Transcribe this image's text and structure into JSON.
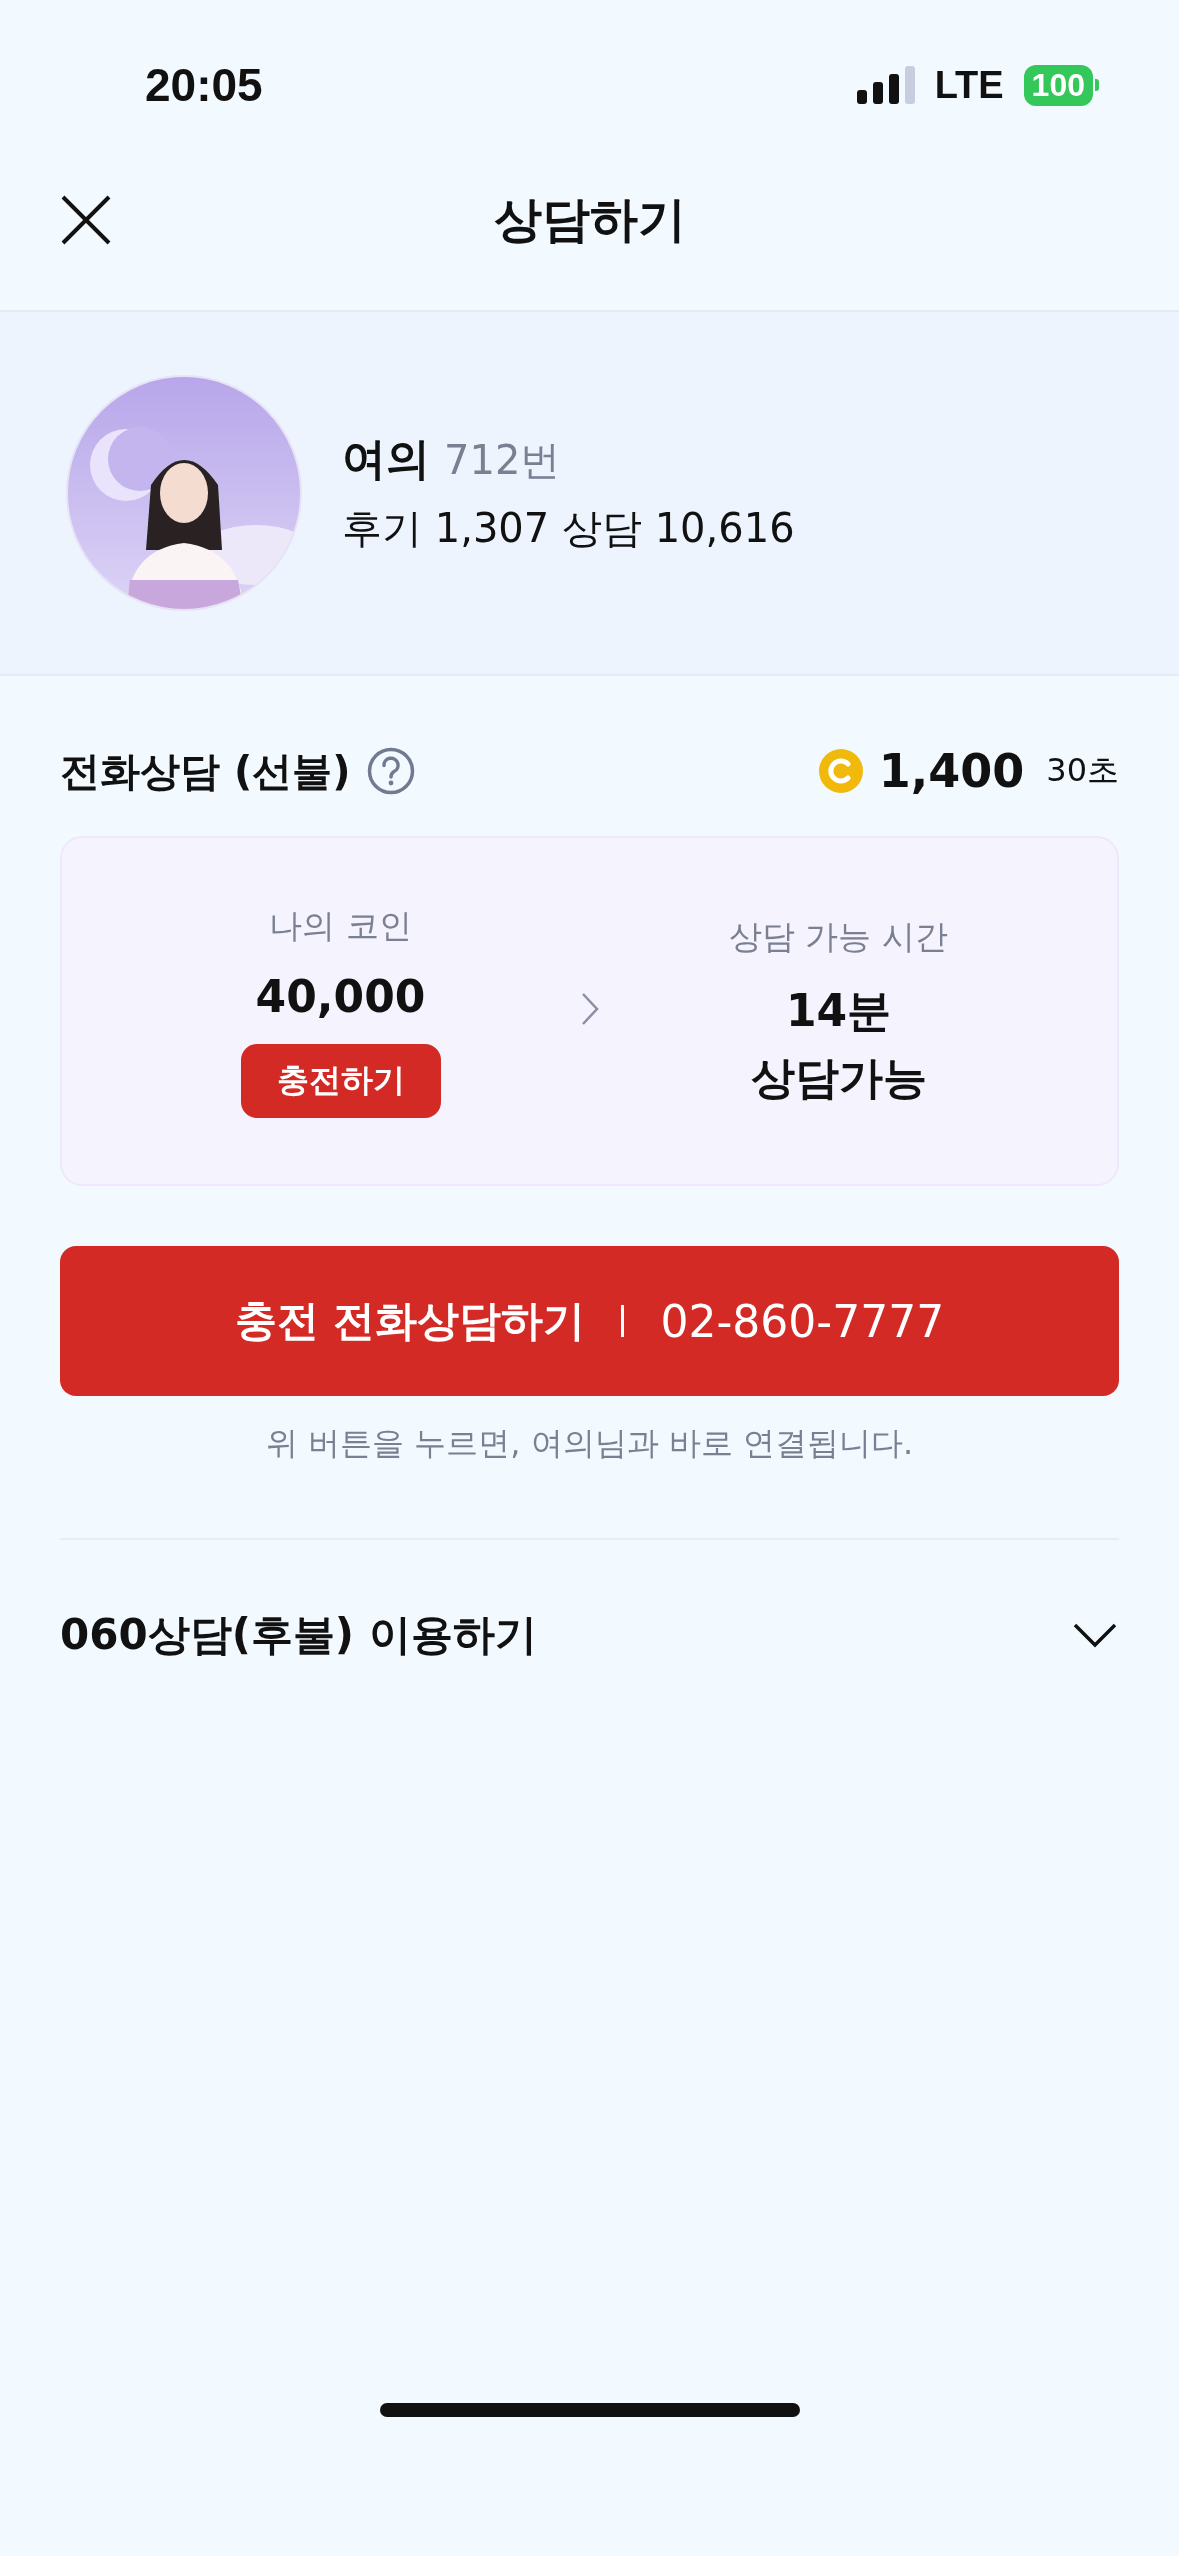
{
  "status_bar": {
    "time": "20:05",
    "network": "LTE",
    "battery": "100"
  },
  "header": {
    "title": "상담하기"
  },
  "counselor": {
    "name": "여의",
    "number": "712번",
    "stats": "후기 1,307 상담 10,616"
  },
  "phone_consult": {
    "title": "전화상담 (선불)",
    "price": "1,400",
    "price_unit": "30초",
    "my_coins_label": "나의 코인",
    "my_coins": "40,000",
    "charge_button": "충전하기",
    "time_label": "상담 가능 시간",
    "time_value": "14분",
    "time_note": "상담가능",
    "call_button": {
      "label": "충전 전화상담하기",
      "phone": "02-860-7777"
    },
    "note": "위 버튼을 누르면, 여의님과 바로 연결됩니다."
  },
  "postpaid": {
    "label": "060상담(후불) 이용하기",
    "expanded": false
  }
}
